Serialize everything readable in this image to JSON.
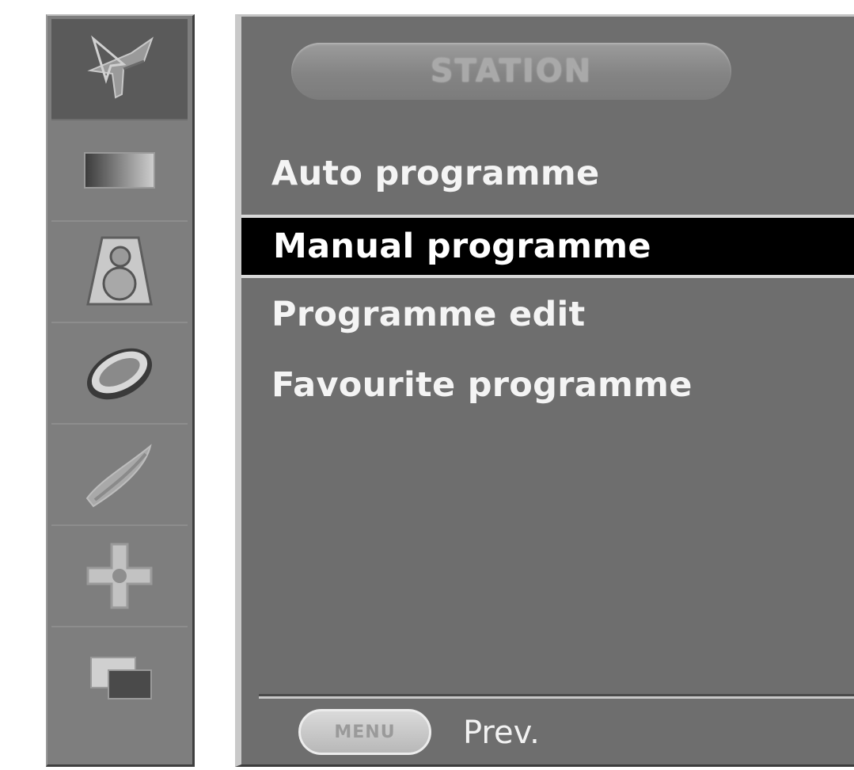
{
  "sidebar": {
    "items": [
      {
        "icon": "station-antenna-icon",
        "active": true
      },
      {
        "icon": "picture-icon",
        "active": false
      },
      {
        "icon": "sound-speaker-icon",
        "active": false
      },
      {
        "icon": "time-clock-icon",
        "active": false
      },
      {
        "icon": "special-icon",
        "active": false
      },
      {
        "icon": "screen-adjust-icon",
        "active": false
      },
      {
        "icon": "pip-icon",
        "active": false
      }
    ]
  },
  "menu": {
    "title": "STATION",
    "items": [
      {
        "label": "Auto programme",
        "selected": false
      },
      {
        "label": "Manual programme",
        "selected": true
      },
      {
        "label": "Programme edit",
        "selected": false
      },
      {
        "label": "Favourite programme",
        "selected": false
      }
    ]
  },
  "footer": {
    "key_label": "MENU",
    "action_label": "Prev."
  },
  "colors": {
    "panel_bg": "#6e6e6e",
    "sidebar_bg": "#7e7e7e",
    "selected_bg": "#000000",
    "text": "#f4f4f4"
  }
}
